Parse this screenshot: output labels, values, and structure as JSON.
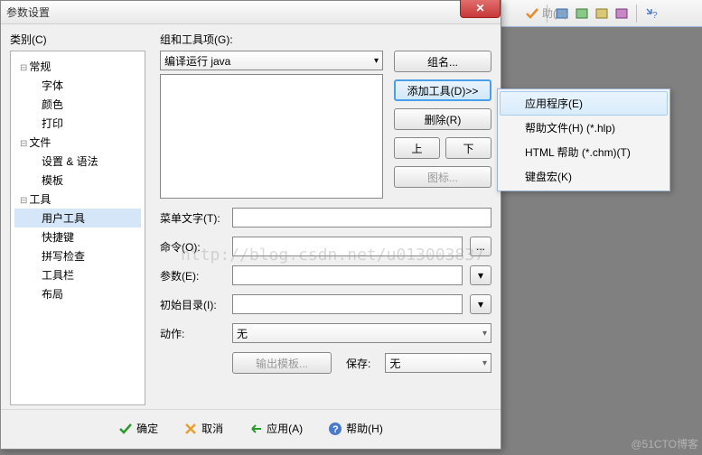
{
  "bg_menu": "助(H)",
  "dialog": {
    "title": "参数设置",
    "category_label": "类别(C)",
    "tree": {
      "general": "常规",
      "font": "字体",
      "color": "颜色",
      "print": "打印",
      "files": "文件",
      "settings": "设置 & 语法",
      "template": "模板",
      "tools": "工具",
      "user_tools": "用户工具",
      "shortcut": "快捷键",
      "spell": "拼写检查",
      "toolbar": "工具栏",
      "layout": "布局"
    },
    "group_label": "组和工具项(G):",
    "combo_value": "编译运行 java",
    "buttons": {
      "group_name": "组名...",
      "add_tool": "添加工具(D)>>",
      "remove": "删除(R)",
      "up": "上",
      "down": "下",
      "icon": "图标..."
    },
    "form": {
      "menu_text": "菜单文字(T):",
      "command": "命令(O):",
      "params": "参数(E):",
      "initial_dir": "初始目录(I):",
      "action": "动作:",
      "action_value": "无",
      "output_template": "输出模板...",
      "save": "保存:",
      "save_value": "无"
    }
  },
  "footer": {
    "ok": "确定",
    "cancel": "取消",
    "apply": "应用(A)",
    "help": "帮助(H)"
  },
  "popup": {
    "app": "应用程序(E)",
    "help_file": "帮助文件(H) (*.hlp)",
    "html_help": "HTML 帮助 (*.chm)(T)",
    "macro": "键盘宏(K)"
  },
  "watermark": "http://blog.csdn.net/u013003837",
  "corner": "@51CTO博客"
}
